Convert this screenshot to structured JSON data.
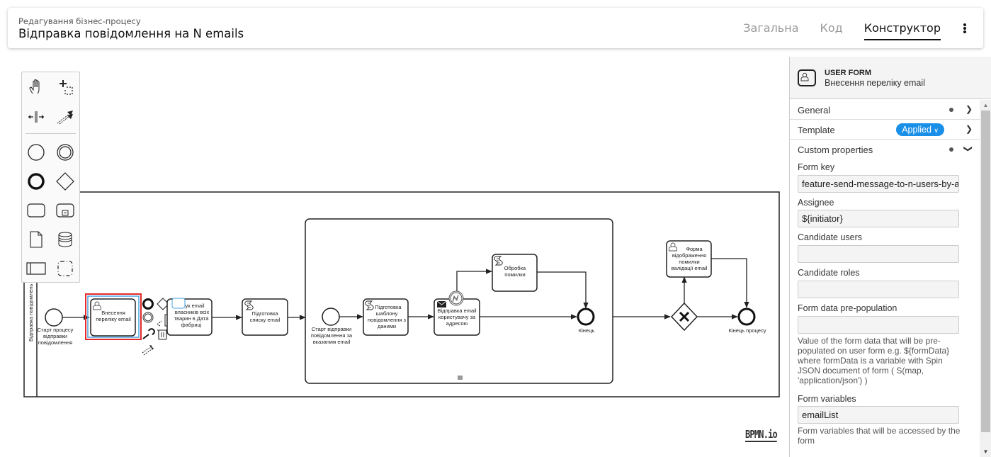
{
  "header": {
    "subtitle": "Редагування бізнес-процесу",
    "title": "Відправка повідомлення на N emails",
    "tabs": [
      {
        "label": "Загальна",
        "active": false
      },
      {
        "label": "Код",
        "active": false
      },
      {
        "label": "Конструктор",
        "active": true
      }
    ],
    "more_icon": "vertical-dots-icon"
  },
  "palette": {
    "tools": [
      "hand-tool",
      "lasso-tool",
      "space-tool",
      "global-connect-tool",
      "start-event",
      "intermediate-event",
      "end-event",
      "gateway",
      "task",
      "subprocess",
      "data-object",
      "data-store",
      "participant",
      "group"
    ]
  },
  "diagram": {
    "pool_label": "Відправка повідомлень",
    "start_event": "Старт процесу відправки повідомлення",
    "task_input": "Внесення переліку email",
    "task_search": "...ук email власників всіх тварин в Дата фабриці",
    "task_prepare_list": "Підготовка списку email",
    "sub_start": "Старт відправки повідомлення за вказаним email",
    "task_template": "Підготовка шаблону повідомлення з даними",
    "task_send": "Відправка email користувачу за адресою",
    "task_error": "Обробка помилки",
    "sub_end": "Кінець",
    "task_error_form": "Форма відображення помилки валідації email",
    "end_event": "Кінець процесу",
    "multi_instance_marker": "≡"
  },
  "watermark": "BPMN.io",
  "panel": {
    "element_type": "USER FORM",
    "element_name": "Внесення переліку email",
    "groups": [
      {
        "label": "General",
        "has_dot": true,
        "expanded": false
      },
      {
        "label": "Template",
        "badge": "Applied",
        "expanded": false
      },
      {
        "label": "Custom properties",
        "has_dot": true,
        "expanded": true
      }
    ],
    "fields": {
      "form_key": {
        "label": "Form key",
        "value": "feature-send-message-to-n-users-by-a"
      },
      "assignee": {
        "label": "Assignee",
        "value": "${initiator}"
      },
      "candidate_users": {
        "label": "Candidate users",
        "value": ""
      },
      "candidate_roles": {
        "label": "Candidate roles",
        "value": ""
      },
      "form_data": {
        "label": "Form data pre-population",
        "value": "",
        "help": "Value of the form data that will be pre-populated on user form e.g. ${formData} where formData is a variable with Spin JSON document of form ( S(map, 'application/json') )"
      },
      "form_variables": {
        "label": "Form variables",
        "value": "emailList",
        "help": "Form variables that will be accessed by the form"
      }
    }
  },
  "colors": {
    "accent": "#1a8fe8",
    "selection": "#e32b2b",
    "selection_inner": "#4aa3df"
  }
}
